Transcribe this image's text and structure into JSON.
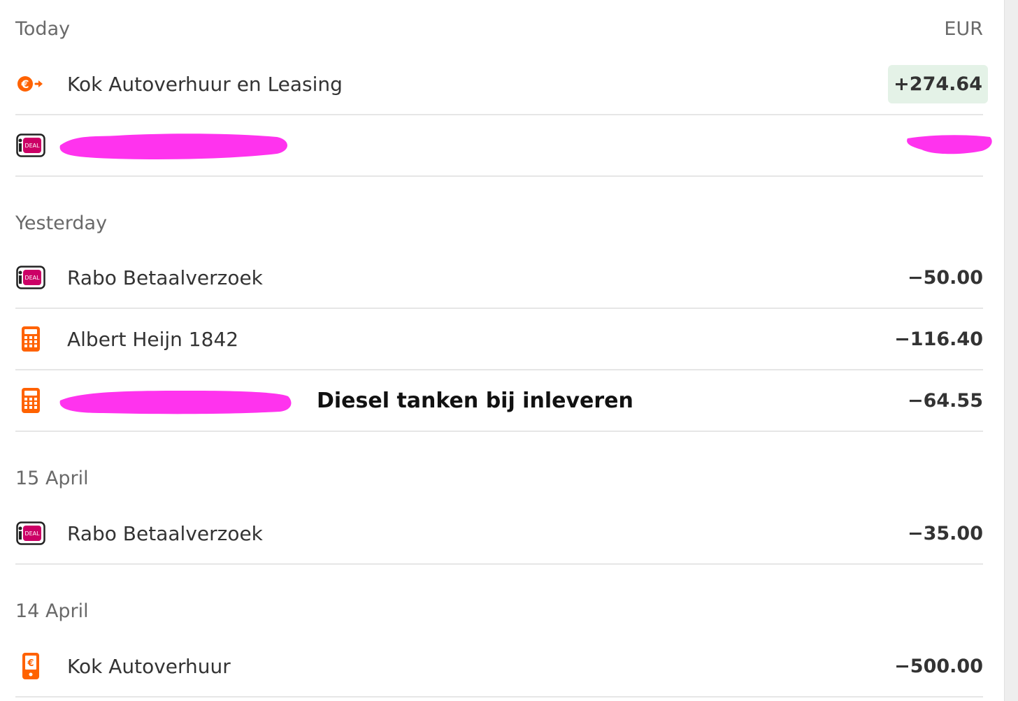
{
  "header": {
    "date_label": "Today",
    "currency": "EUR"
  },
  "colors": {
    "accent_orange": "#ff6200",
    "ideal_pink": "#cc0066",
    "redaction": "#ff33ee",
    "positive_bg": "#e4f2e7"
  },
  "sections": [
    {
      "date": "Today",
      "transactions": [
        {
          "icon": "euro-transfer-icon",
          "name": "Kok Autoverhuur en Leasing",
          "amount": "+274.64"
        },
        {
          "icon": "ideal-icon",
          "name": "",
          "amount": ""
        }
      ]
    },
    {
      "date": "Yesterday",
      "transactions": [
        {
          "icon": "ideal-icon",
          "name": "Rabo Betaalverzoek",
          "amount": "−50.00"
        },
        {
          "icon": "card-terminal-icon",
          "name": "Albert Heijn 1842",
          "amount": "−116.40"
        },
        {
          "icon": "card-terminal-icon",
          "name": "",
          "amount": "−64.55"
        }
      ]
    },
    {
      "date": "15 April",
      "transactions": [
        {
          "icon": "ideal-icon",
          "name": "Rabo Betaalverzoek",
          "amount": "−35.00"
        }
      ]
    },
    {
      "date": "14 April",
      "transactions": [
        {
          "icon": "mobile-payment-icon",
          "name": "Kok Autoverhuur",
          "amount": "−500.00"
        }
      ]
    }
  ],
  "annotation": "Diesel tanken bij inleveren",
  "ideal_text": "DEAL"
}
